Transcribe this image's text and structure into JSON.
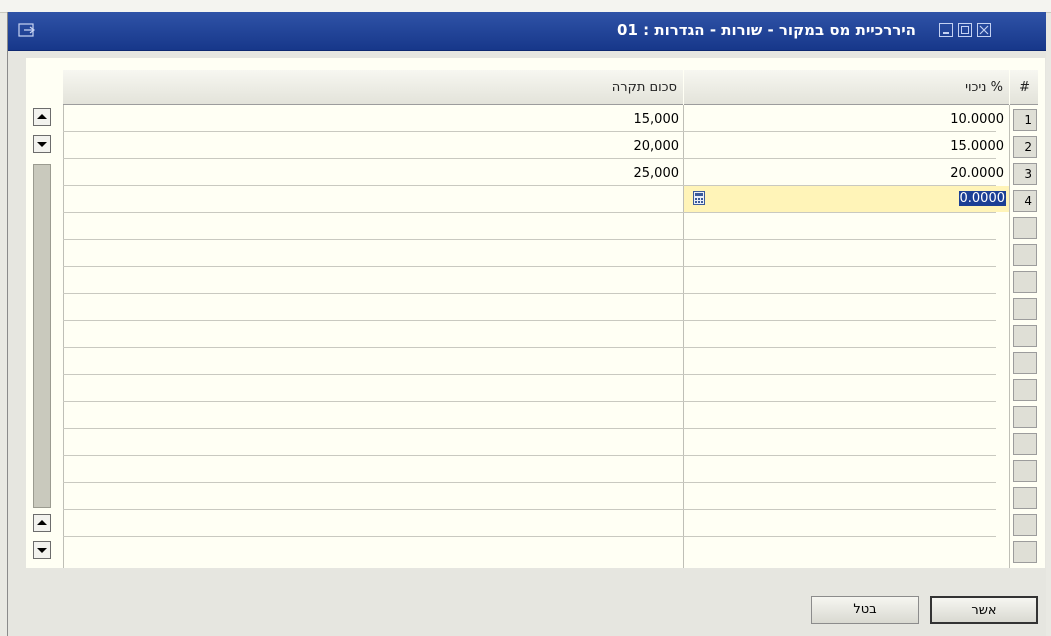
{
  "window": {
    "title": "היררכיית מס במקור - שורות - הגדרות : 01",
    "icons": [
      "menu-icon",
      "minimize-icon",
      "maximize-icon",
      "close-icon"
    ]
  },
  "table": {
    "columns": {
      "row_number": "#",
      "deduction_pct": "% ניכוי",
      "ceiling_amount": "סכום תקרה"
    },
    "rows": [
      {
        "num": "1",
        "deduction_pct": "10.0000",
        "ceiling_amount": "15,000"
      },
      {
        "num": "2",
        "deduction_pct": "15.0000",
        "ceiling_amount": "20,000"
      },
      {
        "num": "3",
        "deduction_pct": "20.0000",
        "ceiling_amount": "25,000"
      },
      {
        "num": "4",
        "deduction_pct": "0.0000",
        "ceiling_amount": ""
      }
    ]
  },
  "buttons": {
    "ok": "אשר",
    "cancel": "בטל"
  },
  "colors": {
    "titlebar": "#1f3f93",
    "active_cell": "#fff4b8",
    "selection": "#1b3f95"
  }
}
